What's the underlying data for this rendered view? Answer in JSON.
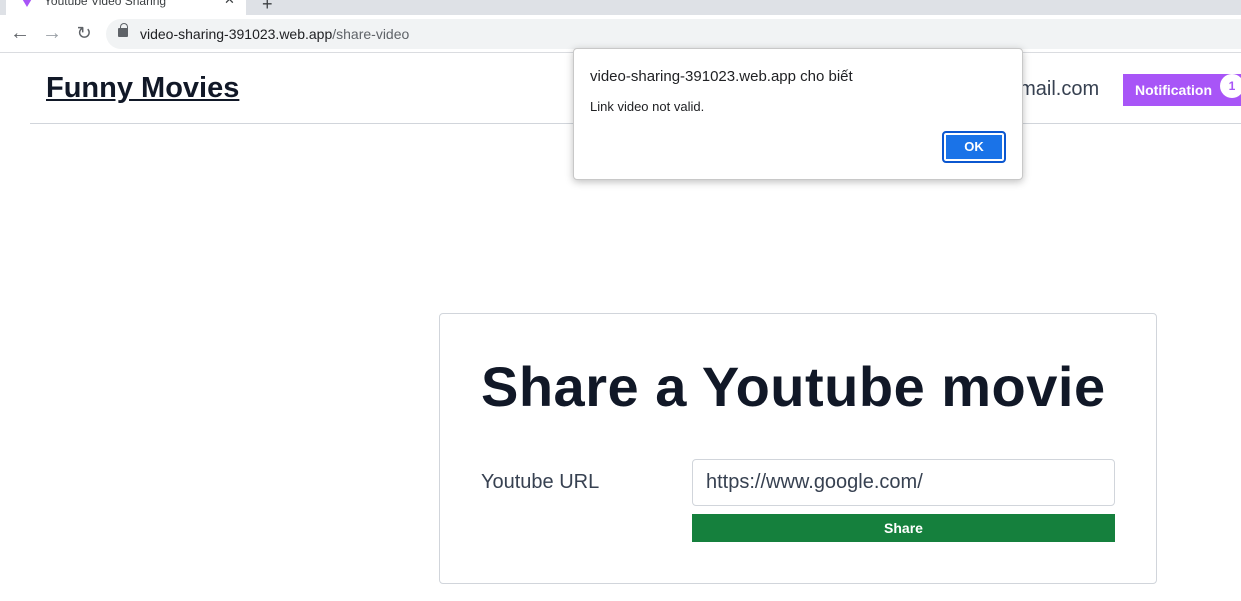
{
  "browser": {
    "tab_title": "Youtube Video Sharing",
    "tab_close": "✕",
    "new_tab": "+",
    "url_host": "video-sharing-391023.web.app",
    "url_path": "/share-video",
    "back_icon": "←",
    "forward_icon": "→",
    "reload_icon": "↻"
  },
  "header": {
    "brand": "Funny Movies",
    "email_partial": "gmail.com",
    "notification_label": "Notification",
    "notification_count": "1",
    "accent_color": "#a855f7"
  },
  "share_form": {
    "title": "Share a Youtube movie",
    "url_label": "Youtube URL",
    "url_value": "https://www.google.com/",
    "submit_label": "Share",
    "submit_color": "#15803d"
  },
  "alert": {
    "title": "video-sharing-391023.web.app cho biết",
    "message": "Link video not valid.",
    "ok_label": "OK",
    "ok_color": "#1a73e8"
  }
}
